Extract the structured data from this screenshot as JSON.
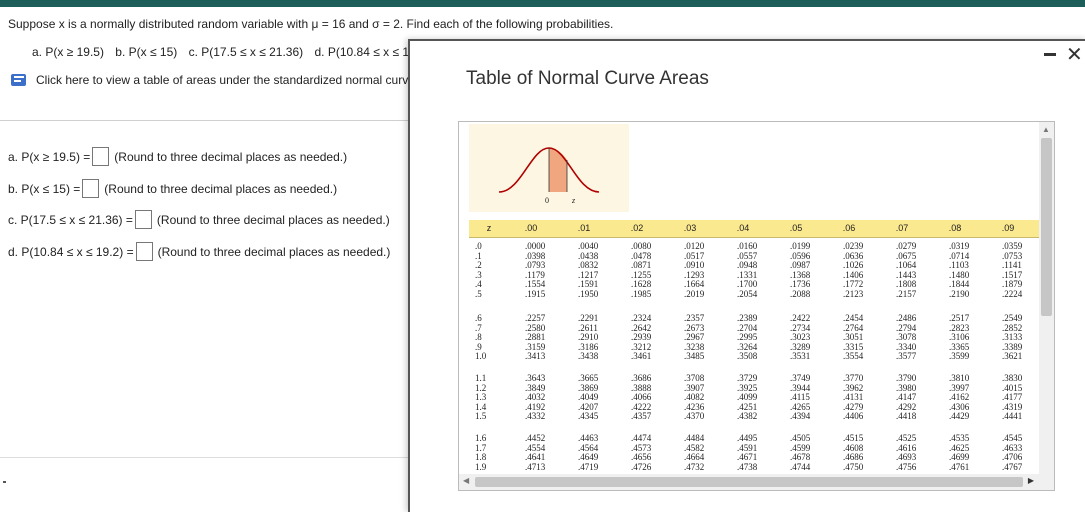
{
  "question": {
    "text": "Suppose x is a normally distributed random variable with μ = 16 and σ = 2. Find each of the following probabilities.",
    "parts": [
      "a. P(x ≥ 19.5)",
      "b. P(x ≤ 15)",
      "c. P(17.5 ≤ x ≤ 21.36)",
      "d. P(10.84 ≤ x ≤ 19.2)"
    ]
  },
  "help_link": "Click here to view a table of areas under the standardized normal curve.",
  "answers": [
    {
      "label": "a. P(x ≥ 19.5) =",
      "hint": "(Round to three decimal places as needed.)"
    },
    {
      "label": "b. P(x ≤ 15) =",
      "hint": "(Round to three decimal places as needed.)"
    },
    {
      "label": "c. P(17.5 ≤ x ≤ 21.36) =",
      "hint": "(Round to three decimal places as needed.)"
    },
    {
      "label": "d. P(10.84 ≤ x ≤ 19.2) =",
      "hint": "(Round to three decimal places as needed.)"
    }
  ],
  "modal": {
    "title": "Table of Normal Curve Areas",
    "minimize": "-",
    "close": "✕"
  },
  "curve": {
    "zero": "0",
    "z": "z"
  },
  "table": {
    "headers": [
      "z",
      ".00",
      ".01",
      ".02",
      ".03",
      ".04",
      ".05",
      ".06",
      ".07",
      ".08",
      ".09"
    ],
    "blocks": [
      {
        "z": [
          ".0",
          ".1",
          ".2",
          ".3",
          ".4",
          ".5"
        ],
        "rows": [
          [
            ".0000",
            ".0040",
            ".0080",
            ".0120",
            ".0160",
            ".0199",
            ".0239",
            ".0279",
            ".0319",
            ".0359"
          ],
          [
            ".0398",
            ".0438",
            ".0478",
            ".0517",
            ".0557",
            ".0596",
            ".0636",
            ".0675",
            ".0714",
            ".0753"
          ],
          [
            ".0793",
            ".0832",
            ".0871",
            ".0910",
            ".0948",
            ".0987",
            ".1026",
            ".1064",
            ".1103",
            ".1141"
          ],
          [
            ".1179",
            ".1217",
            ".1255",
            ".1293",
            ".1331",
            ".1368",
            ".1406",
            ".1443",
            ".1480",
            ".1517"
          ],
          [
            ".1554",
            ".1591",
            ".1628",
            ".1664",
            ".1700",
            ".1736",
            ".1772",
            ".1808",
            ".1844",
            ".1879"
          ],
          [
            ".1915",
            ".1950",
            ".1985",
            ".2019",
            ".2054",
            ".2088",
            ".2123",
            ".2157",
            ".2190",
            ".2224"
          ]
        ]
      },
      {
        "z": [
          ".6",
          ".7",
          ".8",
          ".9",
          "1.0"
        ],
        "rows": [
          [
            ".2257",
            ".2291",
            ".2324",
            ".2357",
            ".2389",
            ".2422",
            ".2454",
            ".2486",
            ".2517",
            ".2549"
          ],
          [
            ".2580",
            ".2611",
            ".2642",
            ".2673",
            ".2704",
            ".2734",
            ".2764",
            ".2794",
            ".2823",
            ".2852"
          ],
          [
            ".2881",
            ".2910",
            ".2939",
            ".2967",
            ".2995",
            ".3023",
            ".3051",
            ".3078",
            ".3106",
            ".3133"
          ],
          [
            ".3159",
            ".3186",
            ".3212",
            ".3238",
            ".3264",
            ".3289",
            ".3315",
            ".3340",
            ".3365",
            ".3389"
          ],
          [
            ".3413",
            ".3438",
            ".3461",
            ".3485",
            ".3508",
            ".3531",
            ".3554",
            ".3577",
            ".3599",
            ".3621"
          ]
        ]
      },
      {
        "z": [
          "1.1",
          "1.2",
          "1.3",
          "1.4",
          "1.5"
        ],
        "rows": [
          [
            ".3643",
            ".3665",
            ".3686",
            ".3708",
            ".3729",
            ".3749",
            ".3770",
            ".3790",
            ".3810",
            ".3830"
          ],
          [
            ".3849",
            ".3869",
            ".3888",
            ".3907",
            ".3925",
            ".3944",
            ".3962",
            ".3980",
            ".3997",
            ".4015"
          ],
          [
            ".4032",
            ".4049",
            ".4066",
            ".4082",
            ".4099",
            ".4115",
            ".4131",
            ".4147",
            ".4162",
            ".4177"
          ],
          [
            ".4192",
            ".4207",
            ".4222",
            ".4236",
            ".4251",
            ".4265",
            ".4279",
            ".4292",
            ".4306",
            ".4319"
          ],
          [
            ".4332",
            ".4345",
            ".4357",
            ".4370",
            ".4382",
            ".4394",
            ".4406",
            ".4418",
            ".4429",
            ".4441"
          ]
        ]
      },
      {
        "z": [
          "1.6",
          "1.7",
          "1.8",
          "1.9"
        ],
        "rows": [
          [
            ".4452",
            ".4463",
            ".4474",
            ".4484",
            ".4495",
            ".4505",
            ".4515",
            ".4525",
            ".4535",
            ".4545"
          ],
          [
            ".4554",
            ".4564",
            ".4573",
            ".4582",
            ".4591",
            ".4599",
            ".4608",
            ".4616",
            ".4625",
            ".4633"
          ],
          [
            ".4641",
            ".4649",
            ".4656",
            ".4664",
            ".4671",
            ".4678",
            ".4686",
            ".4693",
            ".4699",
            ".4706"
          ],
          [
            ".4713",
            ".4719",
            ".4726",
            ".4732",
            ".4738",
            ".4744",
            ".4750",
            ".4756",
            ".4761",
            ".4767"
          ]
        ]
      }
    ]
  },
  "colors": {
    "topbar": "#1d5e5a",
    "header_fill": "#fbe98f",
    "shade": "#f0a780"
  }
}
